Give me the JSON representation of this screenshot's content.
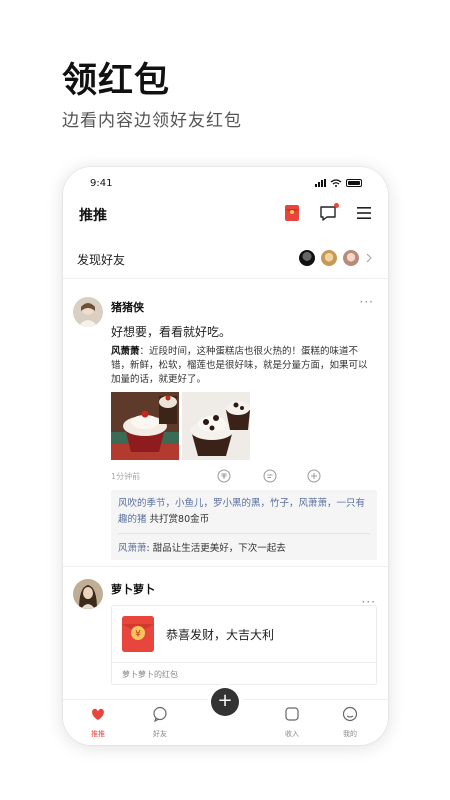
{
  "promo": {
    "title": "领红包",
    "subtitle": "边看内容边领好友红包"
  },
  "status_bar": {
    "time": "9:41"
  },
  "nav": {
    "title": "推推",
    "icons": [
      "red-envelope-icon",
      "message-icon",
      "menu-icon"
    ]
  },
  "find_friends": {
    "label": "发现好友"
  },
  "post1": {
    "username": "猪猪侠",
    "more": "···",
    "text": "好想要，看看就好吃。",
    "comment_author": "风萧萧",
    "comment_text": "：近段时间，这种蛋糕店也很火热的！蛋糕的味道不错，新鲜，松软，榴莲也是很好味，就是分量方面，如果可以加量的话，就更好了。",
    "time": "1分钟前",
    "liked_names": "风吹的季节，小鱼儿，罗小黑的黑，竹子，风萧萧，一只有趣的猪",
    "reward_text": "共打赏80金币",
    "reply_name": "风萧萧",
    "reply_text": ": 甜品让生活更美好，下次一起去"
  },
  "post2": {
    "username": "萝卜萝卜",
    "more": "···",
    "envelope_text": "恭喜发财，大吉大利",
    "envelope_footer": "萝卜萝卜的红包"
  },
  "tabbar": {
    "tabs": [
      {
        "label": "推推",
        "active": true
      },
      {
        "label": "好友"
      },
      {
        "label": "收入"
      },
      {
        "label": "我的"
      }
    ],
    "fab_label": "+"
  },
  "colors": {
    "accent": "#e8453c",
    "link": "#5a6fa0"
  }
}
